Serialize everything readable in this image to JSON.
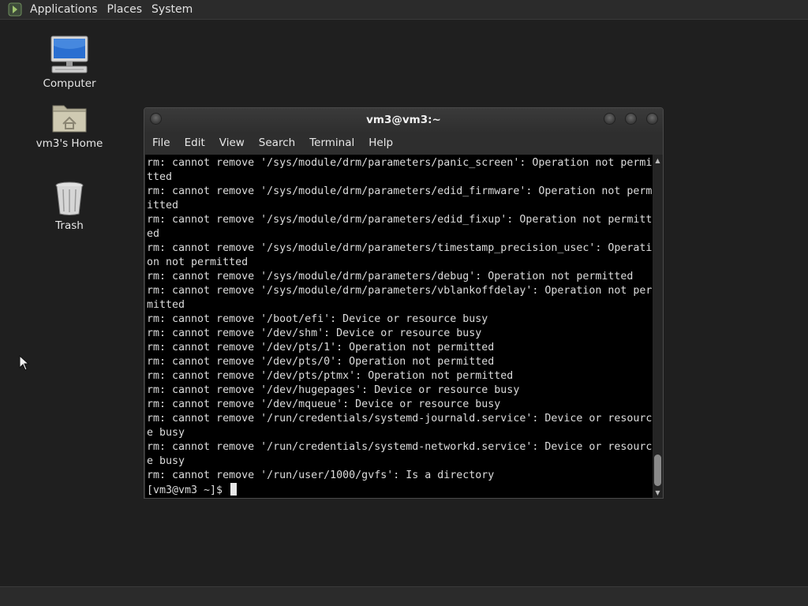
{
  "top_panel": {
    "menus": [
      "Applications",
      "Places",
      "System"
    ]
  },
  "desktop": {
    "icons": [
      {
        "label": "Computer",
        "icon": "computer-icon"
      },
      {
        "label": "vm3's Home",
        "icon": "home-folder-icon"
      },
      {
        "label": "Trash",
        "icon": "trash-icon"
      }
    ]
  },
  "terminal": {
    "title": "vm3@vm3:~",
    "menus": [
      "File",
      "Edit",
      "View",
      "Search",
      "Terminal",
      "Help"
    ],
    "lines": [
      "rm: cannot remove '/sys/module/drm/parameters/panic_screen': Operation not permi",
      "tted",
      "rm: cannot remove '/sys/module/drm/parameters/edid_firmware': Operation not perm",
      "itted",
      "rm: cannot remove '/sys/module/drm/parameters/edid_fixup': Operation not permitt",
      "ed",
      "rm: cannot remove '/sys/module/drm/parameters/timestamp_precision_usec': Operati",
      "on not permitted",
      "rm: cannot remove '/sys/module/drm/parameters/debug': Operation not permitted",
      "rm: cannot remove '/sys/module/drm/parameters/vblankoffdelay': Operation not per",
      "mitted",
      "rm: cannot remove '/boot/efi': Device or resource busy",
      "rm: cannot remove '/dev/shm': Device or resource busy",
      "rm: cannot remove '/dev/pts/1': Operation not permitted",
      "rm: cannot remove '/dev/pts/0': Operation not permitted",
      "rm: cannot remove '/dev/pts/ptmx': Operation not permitted",
      "rm: cannot remove '/dev/hugepages': Device or resource busy",
      "rm: cannot remove '/dev/mqueue': Device or resource busy",
      "rm: cannot remove '/run/credentials/systemd-journald.service': Device or resourc",
      "e busy",
      "rm: cannot remove '/run/credentials/systemd-networkd.service': Device or resourc",
      "e busy",
      "rm: cannot remove '/run/user/1000/gvfs': Is a directory"
    ],
    "prompt": "[vm3@vm3 ~]$ "
  },
  "colors": {
    "desktop_bg": "#1f1f1f",
    "panel_bg": "#2b2b2b",
    "terminal_bg": "#000000",
    "terminal_fg": "#dcdcdc"
  }
}
